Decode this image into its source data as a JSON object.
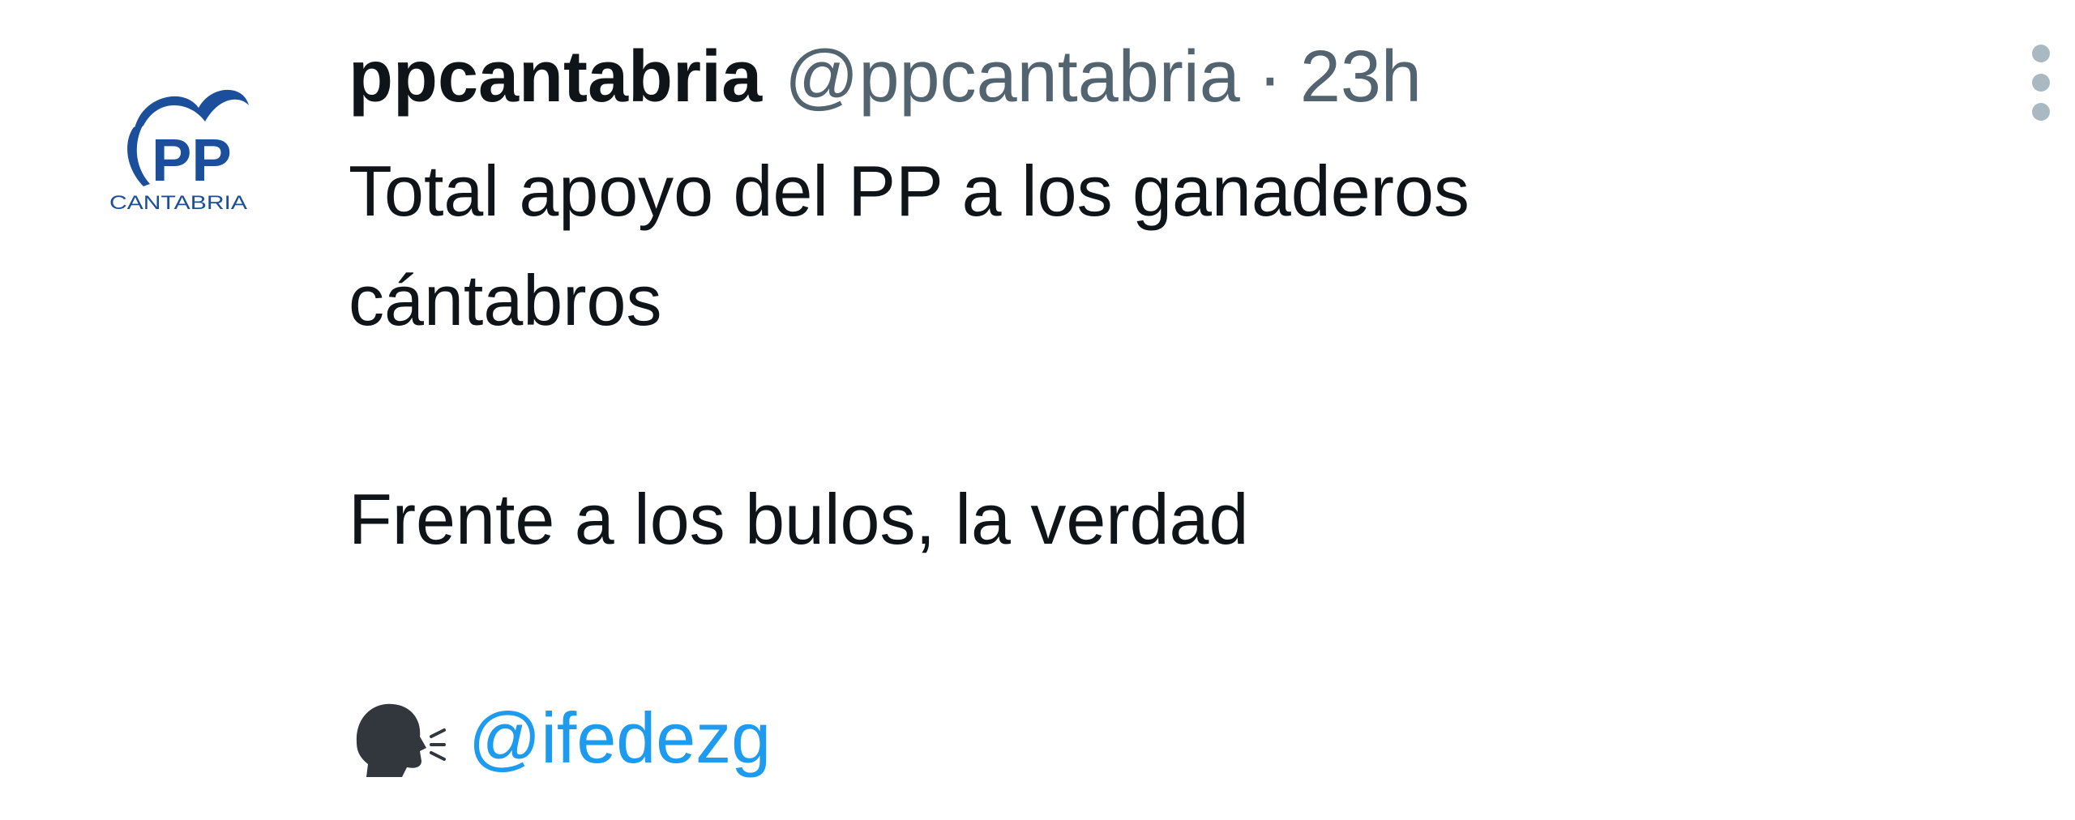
{
  "tweet": {
    "author": {
      "display_name": "ppcantabria",
      "handle": "@ppcantabria",
      "avatar_icon": "pp-cantabria-logo",
      "avatar_caption": "CANTABRIA",
      "avatar_color": "#1b4f9c"
    },
    "separator": "·",
    "time": "23h",
    "body": {
      "line1": "Total apoyo del PP a los ganaderos",
      "line2": "cántabros",
      "line3": "Frente a los bulos, la verdad",
      "mention_icon": "speaking-head-icon",
      "mention": "@ifedezg"
    },
    "menu_icon": "more-options-icon"
  },
  "colors": {
    "text": "#0f1419",
    "secondary": "#536471",
    "link": "#1d9bf0",
    "menu_dots": "#aab8c2"
  }
}
